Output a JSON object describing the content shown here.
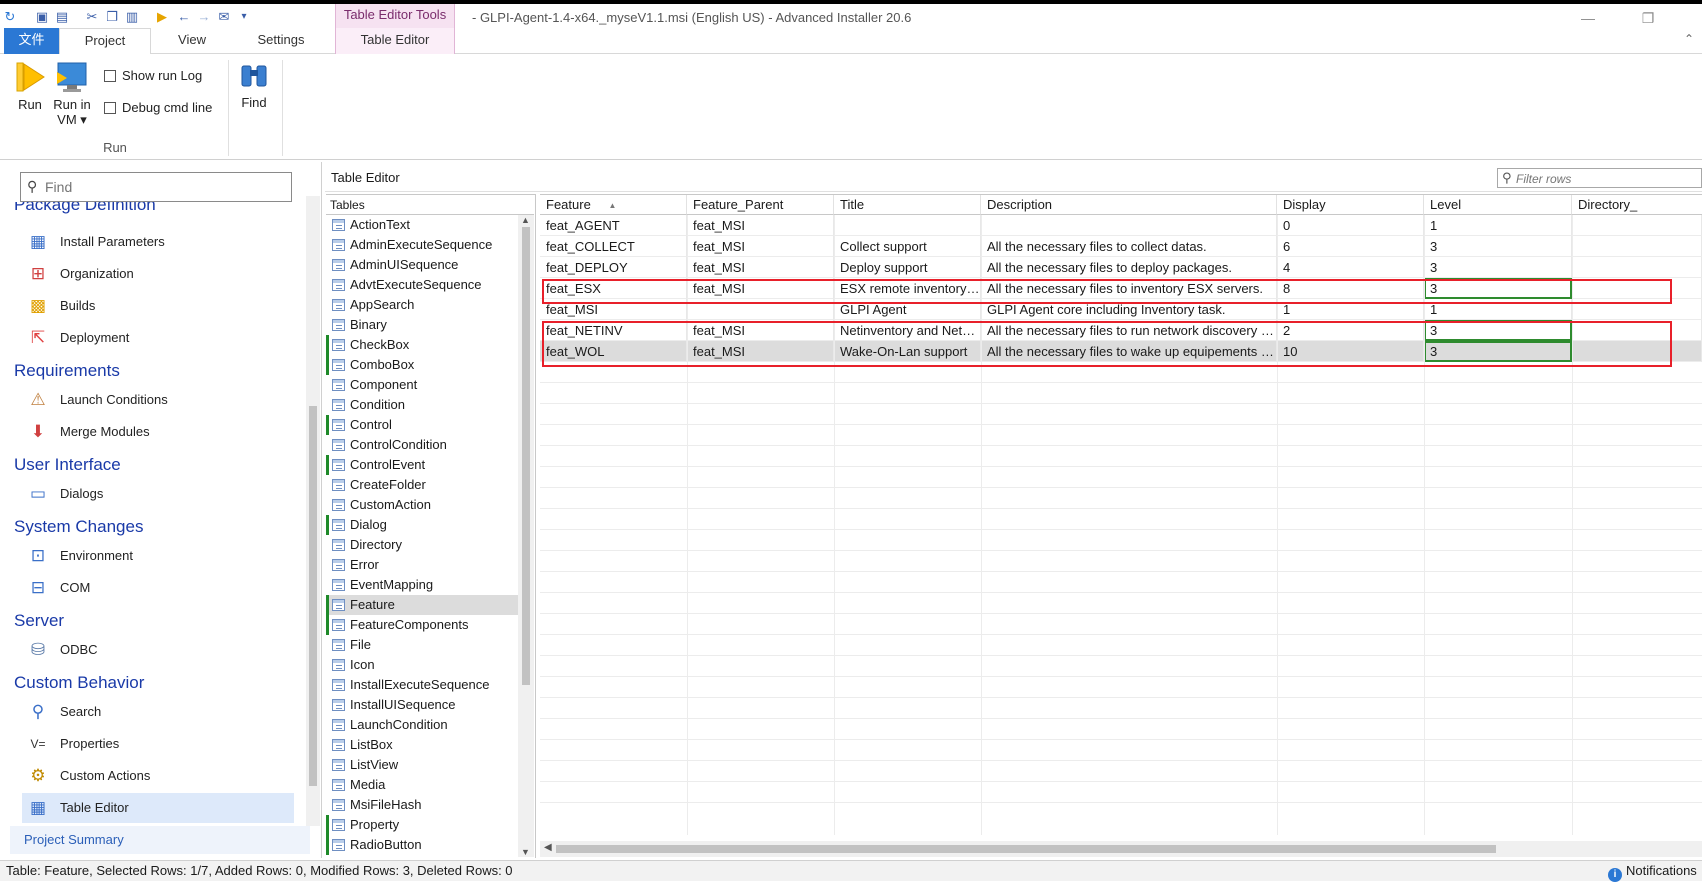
{
  "window": {
    "title": "- GLPI-Agent-1.4-x64._myseV1.1.msi (English US) - Advanced Installer 20.6",
    "context_tab_title": "Table Editor Tools",
    "controls": {
      "minimize": "—",
      "restore": "❐",
      "close": "✕"
    }
  },
  "ribbon": {
    "tabs": {
      "file": "文件",
      "project": "Project",
      "view": "View",
      "settings": "Settings",
      "table_editor": "Table Editor"
    },
    "run_label": "Run",
    "run_in_vm_label": "Run in\nVM ▾",
    "show_run_log": "Show run Log",
    "debug_cmd_line": "Debug cmd line",
    "group_run": "Run",
    "find_label": "Find"
  },
  "left": {
    "find_placeholder": "Find",
    "sections": {
      "package_definition": "Package Definition",
      "requirements": "Requirements",
      "user_interface": "User Interface",
      "system_changes": "System Changes",
      "server": "Server",
      "custom_behavior": "Custom Behavior"
    },
    "items": {
      "install_parameters": "Install Parameters",
      "organization": "Organization",
      "builds": "Builds",
      "deployment": "Deployment",
      "launch_conditions": "Launch Conditions",
      "merge_modules": "Merge Modules",
      "dialogs": "Dialogs",
      "environment": "Environment",
      "com": "COM",
      "odbc": "ODBC",
      "search": "Search",
      "properties": "Properties",
      "custom_actions": "Custom Actions",
      "table_editor": "Table Editor"
    },
    "project_summary": "Project Summary"
  },
  "editor": {
    "title": "Table Editor",
    "filter_placeholder": "Filter rows",
    "tables_header": "Tables",
    "tables": [
      "ActionText",
      "AdminExecuteSequence",
      "AdminUISequence",
      "AdvtExecuteSequence",
      "AppSearch",
      "Binary",
      "CheckBox",
      "ComboBox",
      "Component",
      "Condition",
      "Control",
      "ControlCondition",
      "ControlEvent",
      "CreateFolder",
      "CustomAction",
      "Dialog",
      "Directory",
      "Error",
      "EventMapping",
      "Feature",
      "FeatureComponents",
      "File",
      "Icon",
      "InstallExecuteSequence",
      "InstallUISequence",
      "LaunchCondition",
      "ListBox",
      "ListView",
      "Media",
      "MsiFileHash",
      "Property",
      "RadioButton"
    ],
    "columns": {
      "feature": "Feature",
      "sort_arrow": "▲",
      "feature_parent": "Feature_Parent",
      "title": "Title",
      "description": "Description",
      "display": "Display",
      "level": "Level",
      "directory": "Directory_"
    },
    "rows": [
      {
        "feature": "feat_AGENT",
        "parent": "feat_MSI",
        "title": "",
        "description": "",
        "display": "0",
        "level": "1"
      },
      {
        "feature": "feat_COLLECT",
        "parent": "feat_MSI",
        "title": "Collect support",
        "description": "All the necessary files to collect datas.",
        "display": "6",
        "level": "3"
      },
      {
        "feature": "feat_DEPLOY",
        "parent": "feat_MSI",
        "title": "Deploy support",
        "description": "All the necessary files to deploy packages.",
        "display": "4",
        "level": "3"
      },
      {
        "feature": "feat_ESX",
        "parent": "feat_MSI",
        "title": "ESX remote inventory s...",
        "description": "All the necessary files to inventory ESX servers.",
        "display": "8",
        "level": "3"
      },
      {
        "feature": "feat_MSI",
        "parent": "",
        "title": "GLPI Agent",
        "description": "GLPI Agent core including Inventory task.",
        "display": "1",
        "level": "1"
      },
      {
        "feature": "feat_NETINV",
        "parent": "feat_MSI",
        "title": "Netinventory and NetDi...",
        "description": "All the necessary files to run network discovery an...",
        "display": "2",
        "level": "3"
      },
      {
        "feature": "feat_WOL",
        "parent": "feat_MSI",
        "title": "Wake-On-Lan support",
        "description": "All the necessary files to wake up equipements in y...",
        "display": "10",
        "level": "3"
      }
    ]
  },
  "status": {
    "text": "Table: Feature, Selected Rows: 1/7, Added Rows: 0, Modified Rows: 3, Deleted Rows: 0",
    "notifications": "Notifications"
  }
}
